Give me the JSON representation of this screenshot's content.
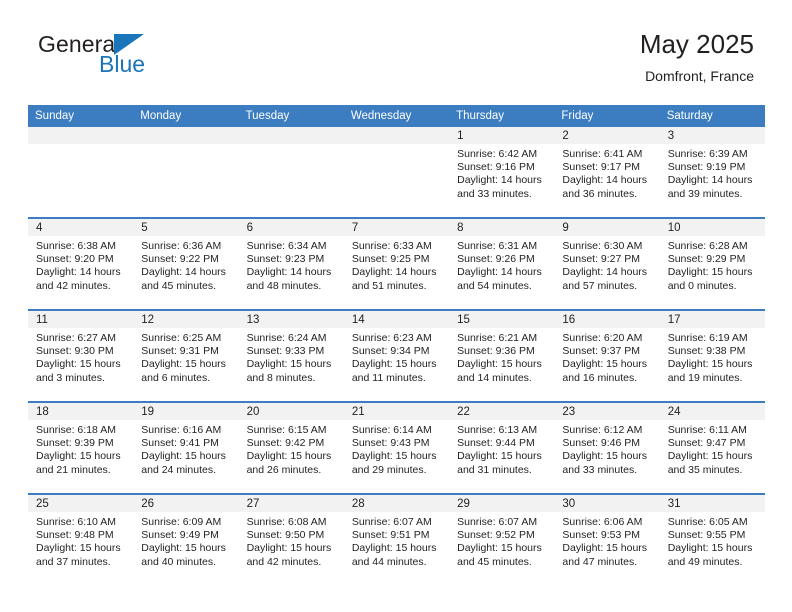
{
  "brand": {
    "name_part1": "General",
    "name_part2": "Blue",
    "logo_icon": "blue-triangle-icon"
  },
  "header": {
    "title": "May 2025",
    "subtitle": "Domfront, France"
  },
  "calendar": {
    "weekday_headers": [
      "Sunday",
      "Monday",
      "Tuesday",
      "Wednesday",
      "Thursday",
      "Friday",
      "Saturday"
    ],
    "labels": {
      "sunrise": "Sunrise:",
      "sunset": "Sunset:",
      "daylight": "Daylight:"
    },
    "weeks": [
      [
        {
          "day": "",
          "empty": true
        },
        {
          "day": "",
          "empty": true
        },
        {
          "day": "",
          "empty": true
        },
        {
          "day": "",
          "empty": true
        },
        {
          "day": "1",
          "sunrise": "Sunrise: 6:42 AM",
          "sunset": "Sunset: 9:16 PM",
          "daylight": "Daylight: 14 hours and 33 minutes."
        },
        {
          "day": "2",
          "sunrise": "Sunrise: 6:41 AM",
          "sunset": "Sunset: 9:17 PM",
          "daylight": "Daylight: 14 hours and 36 minutes."
        },
        {
          "day": "3",
          "sunrise": "Sunrise: 6:39 AM",
          "sunset": "Sunset: 9:19 PM",
          "daylight": "Daylight: 14 hours and 39 minutes."
        }
      ],
      [
        {
          "day": "4",
          "sunrise": "Sunrise: 6:38 AM",
          "sunset": "Sunset: 9:20 PM",
          "daylight": "Daylight: 14 hours and 42 minutes."
        },
        {
          "day": "5",
          "sunrise": "Sunrise: 6:36 AM",
          "sunset": "Sunset: 9:22 PM",
          "daylight": "Daylight: 14 hours and 45 minutes."
        },
        {
          "day": "6",
          "sunrise": "Sunrise: 6:34 AM",
          "sunset": "Sunset: 9:23 PM",
          "daylight": "Daylight: 14 hours and 48 minutes."
        },
        {
          "day": "7",
          "sunrise": "Sunrise: 6:33 AM",
          "sunset": "Sunset: 9:25 PM",
          "daylight": "Daylight: 14 hours and 51 minutes."
        },
        {
          "day": "8",
          "sunrise": "Sunrise: 6:31 AM",
          "sunset": "Sunset: 9:26 PM",
          "daylight": "Daylight: 14 hours and 54 minutes."
        },
        {
          "day": "9",
          "sunrise": "Sunrise: 6:30 AM",
          "sunset": "Sunset: 9:27 PM",
          "daylight": "Daylight: 14 hours and 57 minutes."
        },
        {
          "day": "10",
          "sunrise": "Sunrise: 6:28 AM",
          "sunset": "Sunset: 9:29 PM",
          "daylight": "Daylight: 15 hours and 0 minutes."
        }
      ],
      [
        {
          "day": "11",
          "sunrise": "Sunrise: 6:27 AM",
          "sunset": "Sunset: 9:30 PM",
          "daylight": "Daylight: 15 hours and 3 minutes."
        },
        {
          "day": "12",
          "sunrise": "Sunrise: 6:25 AM",
          "sunset": "Sunset: 9:31 PM",
          "daylight": "Daylight: 15 hours and 6 minutes."
        },
        {
          "day": "13",
          "sunrise": "Sunrise: 6:24 AM",
          "sunset": "Sunset: 9:33 PM",
          "daylight": "Daylight: 15 hours and 8 minutes."
        },
        {
          "day": "14",
          "sunrise": "Sunrise: 6:23 AM",
          "sunset": "Sunset: 9:34 PM",
          "daylight": "Daylight: 15 hours and 11 minutes."
        },
        {
          "day": "15",
          "sunrise": "Sunrise: 6:21 AM",
          "sunset": "Sunset: 9:36 PM",
          "daylight": "Daylight: 15 hours and 14 minutes."
        },
        {
          "day": "16",
          "sunrise": "Sunrise: 6:20 AM",
          "sunset": "Sunset: 9:37 PM",
          "daylight": "Daylight: 15 hours and 16 minutes."
        },
        {
          "day": "17",
          "sunrise": "Sunrise: 6:19 AM",
          "sunset": "Sunset: 9:38 PM",
          "daylight": "Daylight: 15 hours and 19 minutes."
        }
      ],
      [
        {
          "day": "18",
          "sunrise": "Sunrise: 6:18 AM",
          "sunset": "Sunset: 9:39 PM",
          "daylight": "Daylight: 15 hours and 21 minutes."
        },
        {
          "day": "19",
          "sunrise": "Sunrise: 6:16 AM",
          "sunset": "Sunset: 9:41 PM",
          "daylight": "Daylight: 15 hours and 24 minutes."
        },
        {
          "day": "20",
          "sunrise": "Sunrise: 6:15 AM",
          "sunset": "Sunset: 9:42 PM",
          "daylight": "Daylight: 15 hours and 26 minutes."
        },
        {
          "day": "21",
          "sunrise": "Sunrise: 6:14 AM",
          "sunset": "Sunset: 9:43 PM",
          "daylight": "Daylight: 15 hours and 29 minutes."
        },
        {
          "day": "22",
          "sunrise": "Sunrise: 6:13 AM",
          "sunset": "Sunset: 9:44 PM",
          "daylight": "Daylight: 15 hours and 31 minutes."
        },
        {
          "day": "23",
          "sunrise": "Sunrise: 6:12 AM",
          "sunset": "Sunset: 9:46 PM",
          "daylight": "Daylight: 15 hours and 33 minutes."
        },
        {
          "day": "24",
          "sunrise": "Sunrise: 6:11 AM",
          "sunset": "Sunset: 9:47 PM",
          "daylight": "Daylight: 15 hours and 35 minutes."
        }
      ],
      [
        {
          "day": "25",
          "sunrise": "Sunrise: 6:10 AM",
          "sunset": "Sunset: 9:48 PM",
          "daylight": "Daylight: 15 hours and 37 minutes."
        },
        {
          "day": "26",
          "sunrise": "Sunrise: 6:09 AM",
          "sunset": "Sunset: 9:49 PM",
          "daylight": "Daylight: 15 hours and 40 minutes."
        },
        {
          "day": "27",
          "sunrise": "Sunrise: 6:08 AM",
          "sunset": "Sunset: 9:50 PM",
          "daylight": "Daylight: 15 hours and 42 minutes."
        },
        {
          "day": "28",
          "sunrise": "Sunrise: 6:07 AM",
          "sunset": "Sunset: 9:51 PM",
          "daylight": "Daylight: 15 hours and 44 minutes."
        },
        {
          "day": "29",
          "sunrise": "Sunrise: 6:07 AM",
          "sunset": "Sunset: 9:52 PM",
          "daylight": "Daylight: 15 hours and 45 minutes."
        },
        {
          "day": "30",
          "sunrise": "Sunrise: 6:06 AM",
          "sunset": "Sunset: 9:53 PM",
          "daylight": "Daylight: 15 hours and 47 minutes."
        },
        {
          "day": "31",
          "sunrise": "Sunrise: 6:05 AM",
          "sunset": "Sunset: 9:55 PM",
          "daylight": "Daylight: 15 hours and 49 minutes."
        }
      ]
    ]
  },
  "colors": {
    "header_blue": "#3b7dc0",
    "brand_blue": "#1b75bb",
    "daynum_band": "#f2f2f2",
    "text": "#231f20"
  }
}
